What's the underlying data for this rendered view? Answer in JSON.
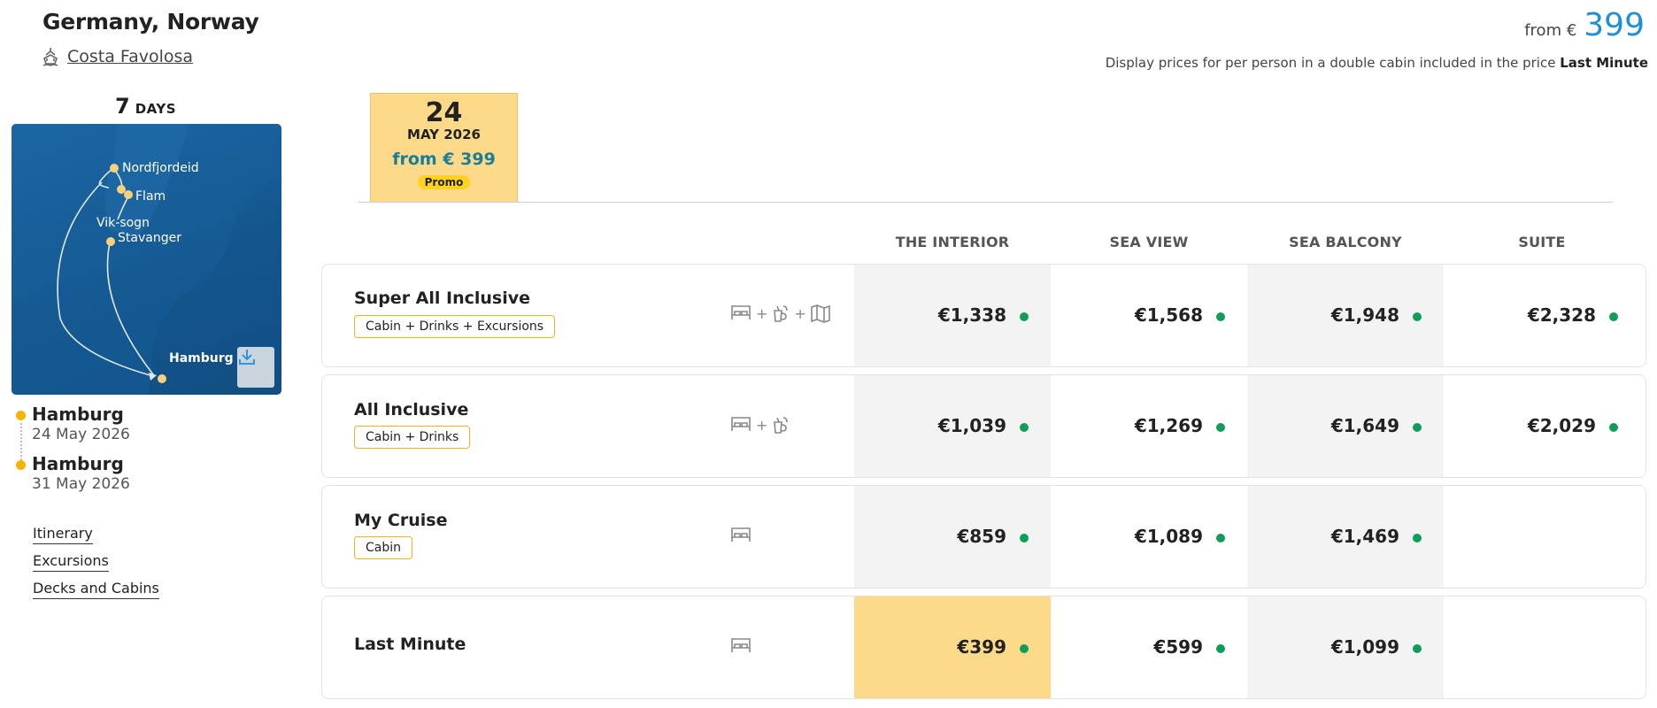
{
  "header": {
    "title": "Germany, Norway",
    "ship": "Costa Favolosa",
    "from_label": "from €",
    "from_amount": "399",
    "note_text": "Display prices for per person in a double cabin included in the price",
    "note_bold": "Last Minute"
  },
  "duration": {
    "number": "7",
    "label": "DAYS"
  },
  "map": {
    "labels": [
      "Nordfjordeid",
      "Flam",
      "Vik-sogn",
      "Stavanger",
      "Hamburg"
    ]
  },
  "stops": [
    {
      "port": "Hamburg",
      "date": "24 May 2026"
    },
    {
      "port": "Hamburg",
      "date": "31 May 2026"
    }
  ],
  "side_links": [
    "Itinerary",
    "Excursions",
    "Decks and Cabins"
  ],
  "date_tab": {
    "day": "24",
    "month": "MAY 2026",
    "price": "from € 399",
    "badge": "Promo"
  },
  "columns": [
    "THE INTERIOR",
    "SEA VIEW",
    "SEA BALCONY",
    "SUITE"
  ],
  "rows": [
    {
      "name": "Super All Inclusive",
      "tag": "Cabin + Drinks + Excursions",
      "prices": [
        "€1,338",
        "€1,568",
        "€1,948",
        "€2,328"
      ]
    },
    {
      "name": "All Inclusive",
      "tag": "Cabin + Drinks",
      "prices": [
        "€1,039",
        "€1,269",
        "€1,649",
        "€2,029"
      ]
    },
    {
      "name": "My Cruise",
      "tag": "Cabin",
      "prices": [
        "€859",
        "€1,089",
        "€1,469"
      ]
    },
    {
      "name": "Last Minute",
      "tag": "",
      "prices": [
        "€399",
        "€599",
        "€1,099"
      ]
    }
  ],
  "colors": {
    "accent_blue": "#1e90d6",
    "highlight": "#fdd98a",
    "tag_border": "#f2b41a",
    "available_dot": "#0f9d58",
    "map_sea": "#13568d"
  }
}
